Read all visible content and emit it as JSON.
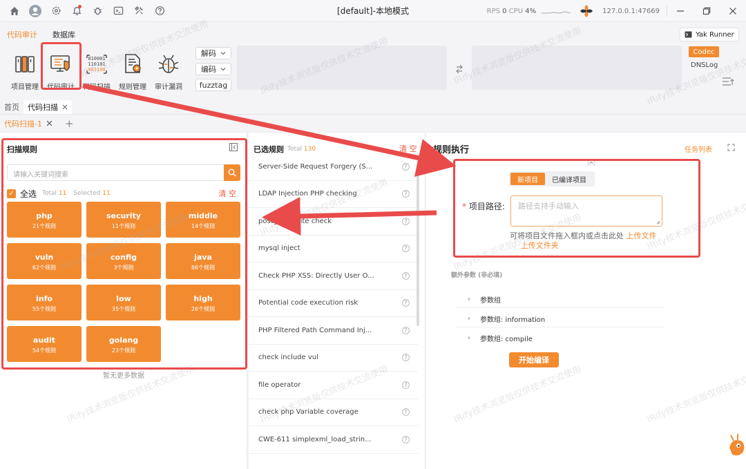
{
  "window": {
    "title": "[default]-本地模式",
    "rps_label": "RPS",
    "rps_value": "0",
    "cpu_label": "CPU",
    "cpu_value": "4%",
    "address": "127.0.0.1:47669"
  },
  "ribbon": {
    "tabs": [
      "代码审计",
      "数据库"
    ],
    "tools": [
      "项目管理",
      "代码审计",
      "代码扫描",
      "规则管理",
      "审计漏洞"
    ],
    "decode_label": "解码",
    "encode_label": "编码",
    "fuzztag_label": "fuzztag",
    "yak_runner_label": "Yak Runner",
    "codec_label": "Codec",
    "dnslog_label": "DNSLog"
  },
  "page_tabs": {
    "home": "首页",
    "code_scan": "代码扫描",
    "subtab": "代码扫描-1"
  },
  "scan_rules": {
    "title": "扫描规则",
    "search_placeholder": "请输入关键词搜索",
    "select_all": "全选",
    "total_label": "Total",
    "total_value": "11",
    "selected_label": "Selected",
    "selected_value": "11",
    "clear": "清 空",
    "no_more": "暂无更多数据",
    "cards": [
      {
        "name": "php",
        "count": "21个规则"
      },
      {
        "name": "security",
        "count": "11个规则"
      },
      {
        "name": "middle",
        "count": "14个规则"
      },
      {
        "name": "vuln",
        "count": "62个规则"
      },
      {
        "name": "config",
        "count": "3个规则"
      },
      {
        "name": "java",
        "count": "86个规则"
      },
      {
        "name": "info",
        "count": "55个规则"
      },
      {
        "name": "low",
        "count": "35个规则"
      },
      {
        "name": "high",
        "count": "26个规则"
      },
      {
        "name": "audit",
        "count": "54个规则"
      },
      {
        "name": "golang",
        "count": "23个规则"
      }
    ]
  },
  "selected_rules": {
    "title": "已选规则",
    "total_label": "Total",
    "total_value": "130",
    "clear": "清 空",
    "rules": [
      "Server-Side Request Forgery (S...",
      "LDAP Injection PHP checking",
      "postgres sqlite check",
      "mysql inject",
      "Check PHP XSS: Directly User O...",
      "Potential code execution risk",
      "PHP Filtered Path Command Inj...",
      "check include vul",
      "file operator",
      "check php Variable coverage",
      "CWE-611 simplexml_load_strin..."
    ]
  },
  "rule_exec": {
    "title": "规则执行",
    "task_list": "任务列表",
    "seg_new": "新项目",
    "seg_compiled": "已编译项目",
    "path_label": "项目路径:",
    "path_placeholder": "路径支持手动输入",
    "hint_prefix": "可将项目文件拖入框内或点击此处",
    "upload_file": "上传文件",
    "upload_folder": "上传文件夹",
    "extra_params": "额外参数 (非必填)",
    "params": [
      "参数组",
      "参数组: information",
      "参数组: compile"
    ],
    "start_button": "开始编译"
  },
  "watermark": "IRify技术浏览版仅供技术交流使用",
  "colors": {
    "accent": "#f28b30",
    "annotation": "#e94b4b"
  }
}
